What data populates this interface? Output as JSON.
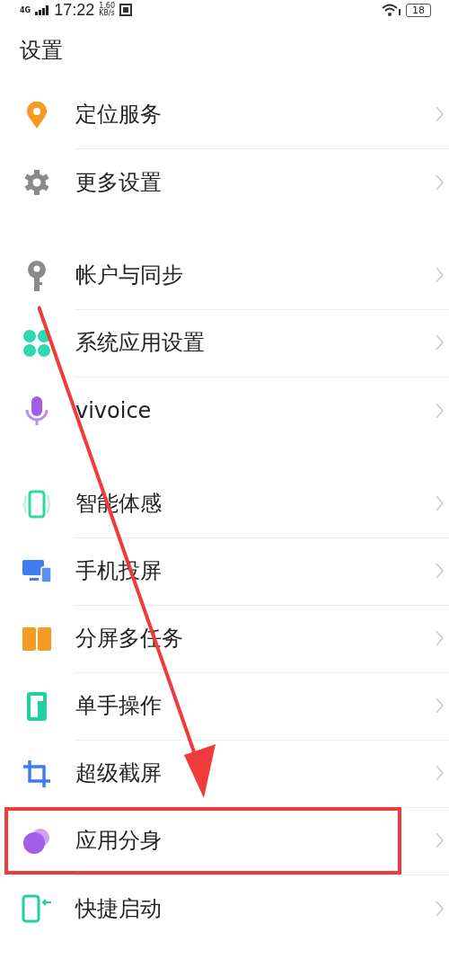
{
  "status_bar": {
    "network": "4G",
    "time": "17:22",
    "speed": "1.60",
    "speed_unit": "KB/s",
    "battery": "18"
  },
  "title": "设置",
  "groups": [
    {
      "items": [
        {
          "label": "定位服务",
          "kind": "location",
          "highlighted": false
        },
        {
          "label": "更多设置",
          "kind": "gear",
          "highlighted": false
        }
      ]
    },
    {
      "items": [
        {
          "label": "帐户与同步",
          "kind": "key",
          "highlighted": false
        },
        {
          "label": "系统应用设置",
          "kind": "clover",
          "highlighted": false
        },
        {
          "label": "vivoice",
          "kind": "mic",
          "highlighted": false
        }
      ]
    },
    {
      "items": [
        {
          "label": "智能体感",
          "kind": "motion",
          "highlighted": false
        },
        {
          "label": "手机投屏",
          "kind": "cast",
          "highlighted": false
        },
        {
          "label": "分屏多任务",
          "kind": "split",
          "highlighted": false
        },
        {
          "label": "单手操作",
          "kind": "onehand",
          "highlighted": false
        },
        {
          "label": "超级截屏",
          "kind": "crop",
          "highlighted": false
        },
        {
          "label": "应用分身",
          "kind": "clone",
          "highlighted": true
        },
        {
          "label": "快捷启动",
          "kind": "quick",
          "highlighted": false
        }
      ]
    }
  ]
}
